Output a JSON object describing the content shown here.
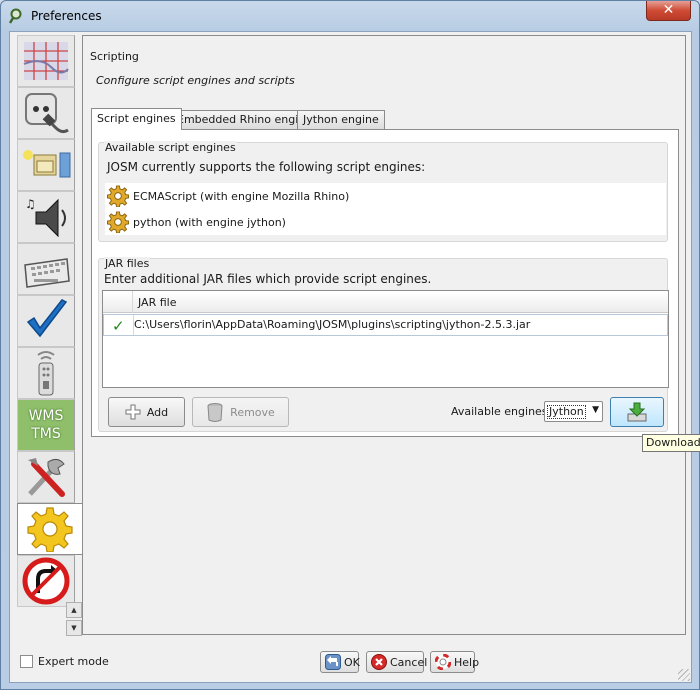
{
  "window": {
    "title": "Preferences",
    "close_label": "✕"
  },
  "sidebar": {
    "items": [
      {
        "name": "map-grid",
        "icon": "map-grid-icon"
      },
      {
        "name": "connection",
        "icon": "plug-icon"
      },
      {
        "name": "display",
        "icon": "folder-icon"
      },
      {
        "name": "audio",
        "icon": "speaker-icon"
      },
      {
        "name": "shortcuts",
        "icon": "keyboard-icon"
      },
      {
        "name": "validator",
        "icon": "checkmark-icon"
      },
      {
        "name": "remote-control",
        "icon": "remote-icon"
      },
      {
        "name": "imagery",
        "icon": "wms-tms-icon",
        "line1": "WMS",
        "line2": "TMS"
      },
      {
        "name": "advanced",
        "icon": "tools-icon"
      },
      {
        "name": "scripting",
        "icon": "gear-icon",
        "selected": true
      },
      {
        "name": "turn-restrictions",
        "icon": "no-turn-icon"
      }
    ]
  },
  "main": {
    "title": "Scripting",
    "description": "Configure script engines and scripts",
    "tabs": [
      {
        "label": "Script engines",
        "active": true
      },
      {
        "label": "Embedded Rhino engine",
        "active": false
      },
      {
        "label": "Jython engine",
        "active": false
      }
    ],
    "engines": {
      "group_label": "Available script engines",
      "intro": "JOSM currently supports the following script engines:",
      "items": [
        {
          "label": "ECMAScript (with engine Mozilla Rhino)",
          "icon": "gear-icon"
        },
        {
          "label": "python (with engine jython)",
          "icon": "gear-icon"
        }
      ]
    },
    "jar_files": {
      "group_label": "JAR files",
      "intro": "Enter additional JAR files which provide script engines.",
      "column_header": "JAR file",
      "rows": [
        {
          "valid": true,
          "path": "C:\\Users\\florin\\AppData\\Roaming\\JOSM\\plugins\\scripting\\jython-2.5.3.jar"
        }
      ],
      "add_label": "Add",
      "remove_label": "Remove",
      "available_engines_label": "Available engines:",
      "selected_engine": "Jython",
      "download_tooltip": "Download"
    }
  },
  "footer": {
    "expert_mode_label": "Expert mode",
    "expert_mode_checked": false,
    "ok_label": "OK",
    "cancel_label": "Cancel",
    "help_label": "Help"
  },
  "colors": {
    "window_frame": "#b9cde4",
    "panel_bg": "#f0f0f0",
    "gear": "#e8b21e",
    "check": "#1b8a1b",
    "close_button": "#cf4b36",
    "tooltip_bg": "#ffffe1"
  }
}
